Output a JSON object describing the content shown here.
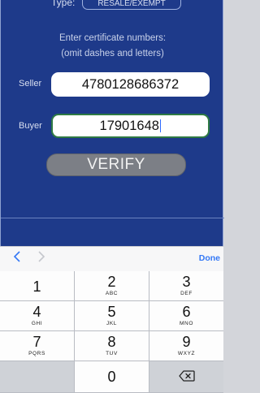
{
  "form": {
    "type_label": "Type:",
    "type_value": "RESALE/EXEMPT",
    "instruction_line1": "Enter certificate numbers:",
    "instruction_line2": "(omit dashes and letters)",
    "seller_label": "Seller",
    "seller_value": "4780128686372",
    "buyer_label": "Buyer",
    "buyer_value": "17901648",
    "verify_label": "VERIFY"
  },
  "accessory": {
    "prev_icon": "chevron-left-icon",
    "next_icon": "chevron-right-icon",
    "done_label": "Done"
  },
  "keypad": {
    "keys": [
      {
        "num": "1",
        "letters": ""
      },
      {
        "num": "2",
        "letters": "ABC"
      },
      {
        "num": "3",
        "letters": "DEF"
      },
      {
        "num": "4",
        "letters": "GHI"
      },
      {
        "num": "5",
        "letters": "JKL"
      },
      {
        "num": "6",
        "letters": "MNO"
      },
      {
        "num": "7",
        "letters": "PQRS"
      },
      {
        "num": "8",
        "letters": "TUV"
      },
      {
        "num": "9",
        "letters": "WXYZ"
      },
      {
        "num": "0",
        "letters": ""
      }
    ],
    "backspace_icon": "backspace-icon"
  },
  "colors": {
    "app_background": "#1e3a8a",
    "accent": "#3478f6",
    "active_field_border": "#2f7a44"
  }
}
